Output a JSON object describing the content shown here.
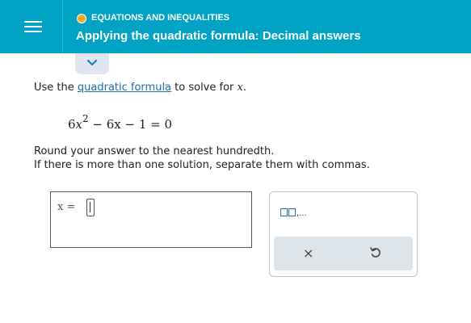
{
  "header": {
    "menu_icon": "hamburger-menu-icon",
    "topic_label": "EQUATIONS AND INEQUALITIES",
    "title": "Applying the quadratic formula: Decimal answers",
    "colors": {
      "header_bg": "#00a3c4",
      "topic_dot": "#f5a623"
    }
  },
  "collapse_icon": "chevron-down-icon",
  "problem": {
    "instruction_pre": "Use the ",
    "instruction_link": "quadratic formula",
    "instruction_post": " to solve for ",
    "variable": "x",
    "period": ".",
    "equation": {
      "coef": "6",
      "var": "x",
      "exponent": "2",
      "rest": " − 6x − 1 = 0"
    },
    "round_text": "Round your answer to the nearest hundredth.",
    "separator_text": "If there is more than one solution, separate them with commas."
  },
  "answer": {
    "label": "x =",
    "value": ""
  },
  "tools": {
    "list_icon": "list-template-icon",
    "list_suffix": ",...",
    "clear_symbol": "×",
    "undo_icon": "undo-icon"
  }
}
